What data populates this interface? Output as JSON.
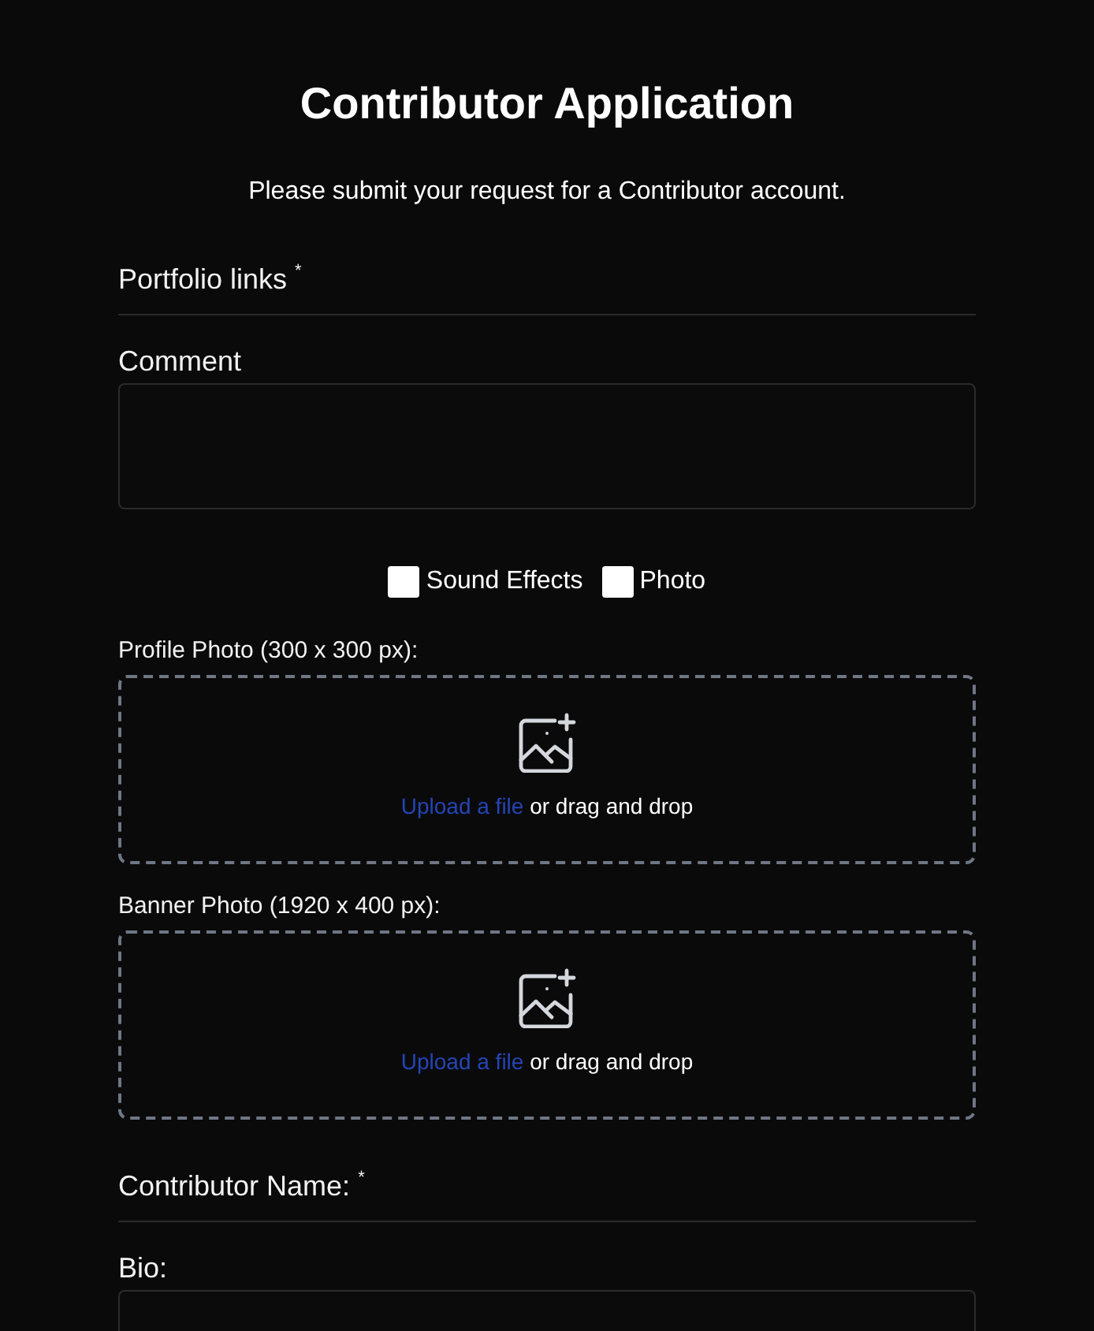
{
  "title": "Contributor Application",
  "subtitle": "Please submit your request for a Contributor account.",
  "fields": [
    {
      "kind": "heading",
      "label": "Portfolio links $^{*}$"
    },
    {
      "kind": "textarea",
      "label": "Comment"
    },
    {
      "kind": "checkboxes",
      "options": [
        {
          "label": "Sound Effects",
          "checked": false
        },
        {
          "label": "Photo",
          "checked": false
        }
      ]
    },
    {
      "kind": "upload",
      "label": "Profile Photo (300 x 300 px):",
      "link": "Upload a file",
      "text": "or drag and drop"
    },
    {
      "kind": "upload",
      "label": "Banner Photo (1920 x 400 px):",
      "link": "Upload a file",
      "text": "or drag and drop"
    },
    {
      "kind": "heading",
      "label": "Contributor Name: $^{*}$"
    },
    {
      "kind": "textarea",
      "label": "Bio:"
    }
  ]
}
